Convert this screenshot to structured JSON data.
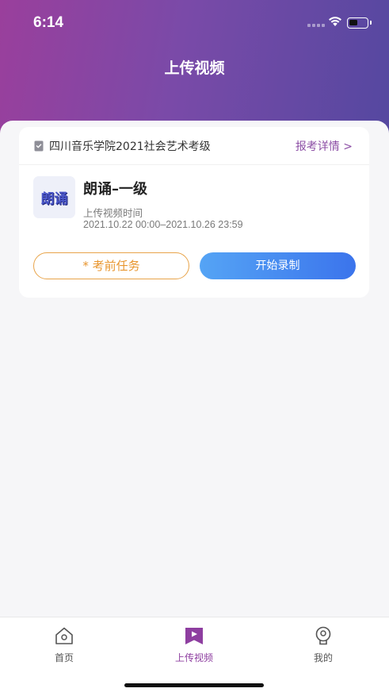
{
  "status_bar": {
    "time": "6:14"
  },
  "header": {
    "title": "上传视频"
  },
  "exam_card": {
    "org_name": "四川音乐学院2021社会艺术考级",
    "detail_link": "报考详情 >",
    "thumb_text": "朗诵",
    "subject_title": "朗诵–一级",
    "time_label": "上传视频时间",
    "time_range": "2021.10.22 00:00–2021.10.26 23:59",
    "task_button": "* 考前任务",
    "record_button": "开始录制"
  },
  "tab_bar": {
    "items": [
      {
        "label": "首页",
        "icon": "home-icon",
        "active": false
      },
      {
        "label": "上传视频",
        "icon": "upload-video-icon",
        "active": true
      },
      {
        "label": "我的",
        "icon": "profile-icon",
        "active": false
      }
    ]
  },
  "colors": {
    "header_gradient_start": "#9a3f9c",
    "header_gradient_end": "#5448a0",
    "accent_purple": "#8c4ea5",
    "task_orange": "#e8962f",
    "record_blue_start": "#55a4f5",
    "record_blue_end": "#3b74ec"
  }
}
